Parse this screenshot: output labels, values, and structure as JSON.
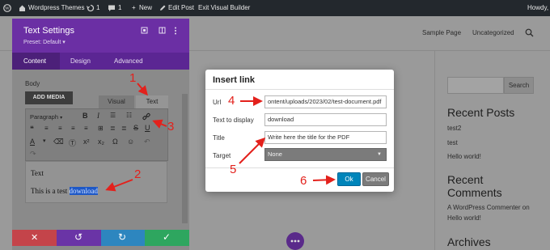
{
  "adminbar": {
    "site_name": "Wordpress Themes",
    "updates_count": "1",
    "comments_count": "1",
    "new_label": "New",
    "edit_post": "Edit Post",
    "visual_builder": "Exit Visual Builder",
    "greeting": "Howdy, "
  },
  "site": {
    "nav": [
      "Sample Page",
      "Uncategorized"
    ],
    "search_button": "Search",
    "recent_posts_title": "Recent Posts",
    "recent_posts": [
      "test2",
      "test",
      "Hello world!"
    ],
    "recent_comments_title": "Recent Comments",
    "comment_author": "A WordPress Commenter",
    "comment_on": "on",
    "comment_post": "Hello world!",
    "archives_title": "Archives"
  },
  "panel": {
    "title": "Text Settings",
    "preset": "Preset: Default",
    "tabs": [
      "Content",
      "Design",
      "Advanced"
    ],
    "body_label": "Body",
    "add_media": "ADD MEDIA",
    "visual_tab": "Visual",
    "text_tab": "Text",
    "format_select": "Paragraph",
    "editor_line1": "Text",
    "editor_line2": "This is a test ",
    "editor_selected": "download"
  },
  "modal": {
    "title": "Insert link",
    "url_label": "Url",
    "url_value": "ontent/uploads/2023/02/test-document.pdf",
    "text_label": "Text to display",
    "text_value": "download",
    "title_label": "Title",
    "title_value": "Write here the title for the PDF",
    "target_label": "Target",
    "target_value": "None",
    "ok": "Ok",
    "cancel": "Cancel"
  },
  "annotations": [
    "1",
    "2",
    "3",
    "4",
    "5",
    "6"
  ],
  "colors": {
    "divi_purple": "#6b2fa4",
    "annotation_red": "#e3211c",
    "ok_blue": "#0085ba"
  }
}
